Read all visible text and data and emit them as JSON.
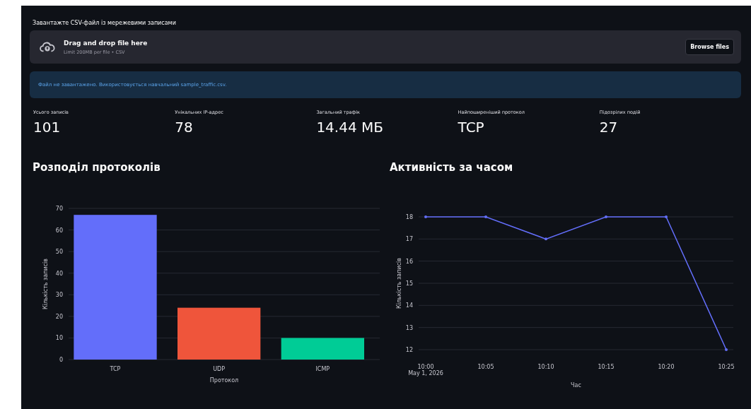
{
  "uploader": {
    "label": "Завантажте CSV-файл із мережевими записами",
    "title": "Drag and drop file here",
    "hint": "Limit 200MB per file • CSV",
    "button": "Browse files"
  },
  "info": "Файл не завантажено. Використовується навчальний sample_traffic.csv.",
  "metrics": [
    {
      "label": "Усього записів",
      "value": "101"
    },
    {
      "label": "Унікальних IP-адрес",
      "value": "78"
    },
    {
      "label": "Загальний трафік",
      "value": "14.44 МБ"
    },
    {
      "label": "Найпоширеніший протокол",
      "value": "TCP"
    },
    {
      "label": "Підозрілих подій",
      "value": "27"
    }
  ],
  "charts": [
    {
      "title": "Розподіл протоколів",
      "chart_data": {
        "type": "bar",
        "xlabel": "Протокол",
        "ylabel": "Кількість записів",
        "categories": [
          "TCP",
          "UDP",
          "ICMP"
        ],
        "series": [
          {
            "color": "#636efa",
            "values": [
              67,
              null,
              null
            ]
          },
          {
            "color": "#ef553b",
            "values": [
              null,
              24,
              null
            ]
          },
          {
            "color": "#00cc96",
            "values": [
              null,
              null,
              10
            ]
          }
        ],
        "grid": true,
        "ylim": [
          0,
          70
        ],
        "yticks": [
          0,
          10,
          20,
          30,
          40,
          50,
          60,
          70
        ]
      }
    },
    {
      "title": "Активність за часом",
      "chart_data": {
        "type": "line",
        "xlabel": "Час",
        "ylabel": "Кількість записів",
        "categories": [
          "10:00\nMay 1, 2026",
          "10:05",
          "10:10",
          "10:15",
          "10:20",
          "10:25"
        ],
        "series": [
          {
            "color": "#636efa",
            "values": [
              18,
              18,
              17,
              18,
              18,
              12
            ]
          }
        ],
        "grid": true,
        "ylim": [
          12,
          18
        ],
        "yticks": [
          12,
          13,
          14,
          15,
          16,
          17,
          18
        ]
      }
    }
  ]
}
